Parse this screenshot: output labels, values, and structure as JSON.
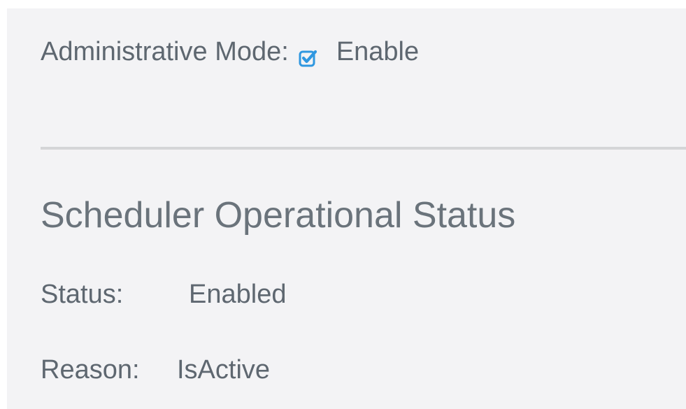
{
  "admin_mode": {
    "label": "Administrative Mode:",
    "checkbox_checked": true,
    "option_label": "Enable",
    "checkbox_color": "#2f97e0"
  },
  "scheduler": {
    "title": "Scheduler Operational Status",
    "status_label": "Status:",
    "status_value": "Enabled",
    "reason_label": "Reason:",
    "reason_value": "IsActive"
  }
}
